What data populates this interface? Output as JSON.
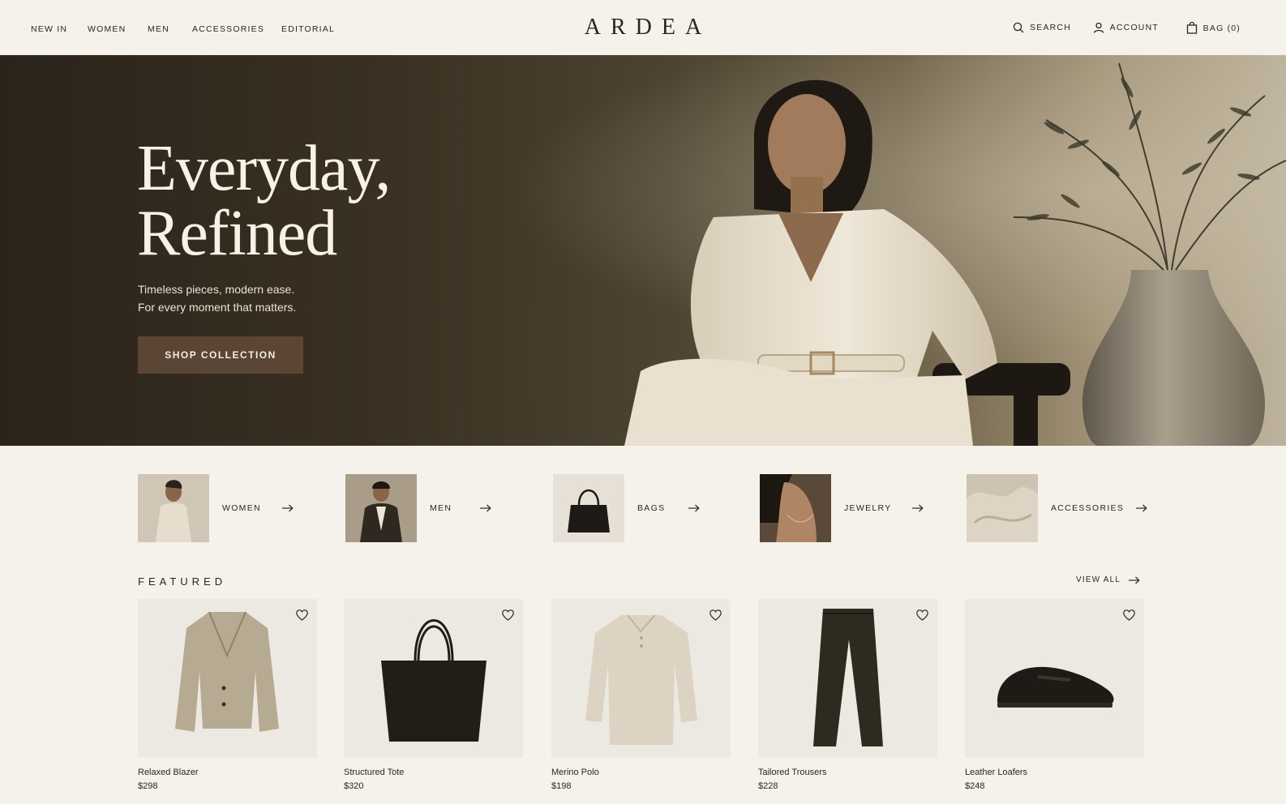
{
  "colors": {
    "background": "#f5f2ec",
    "text": "#2a2520",
    "cta": "#5b4535"
  },
  "header": {
    "nav": [
      "NEW IN",
      "WOMEN",
      "MEN",
      "ACCESSORIES",
      "EDITORIAL"
    ],
    "logo": "ARDEA",
    "search": {
      "label": "SEARCH",
      "icon": "search-icon"
    },
    "account": {
      "label": "ACCOUNT",
      "icon": "user-icon"
    },
    "bag": {
      "label": "BAG (0)",
      "icon": "bag-icon"
    }
  },
  "hero": {
    "title_line1": "Everyday,",
    "title_line2": "Refined",
    "subtitle_line1": "Timeless pieces, modern ease.",
    "subtitle_line2": "For every moment that matters.",
    "cta": "SHOP COLLECTION"
  },
  "categories": [
    {
      "label": "WOMEN"
    },
    {
      "label": "MEN"
    },
    {
      "label": "BAGS"
    },
    {
      "label": "JEWELRY"
    },
    {
      "label": "ACCESSORIES"
    }
  ],
  "featured": {
    "title": "FEATURED",
    "view_all": "VIEW ALL",
    "products": [
      {
        "name": "Relaxed Blazer",
        "price": "$298"
      },
      {
        "name": "Structured Tote",
        "price": "$320"
      },
      {
        "name": "Merino Polo",
        "price": "$198"
      },
      {
        "name": "Tailored Trousers",
        "price": "$228"
      },
      {
        "name": "Leather Loafers",
        "price": "$248"
      }
    ]
  }
}
